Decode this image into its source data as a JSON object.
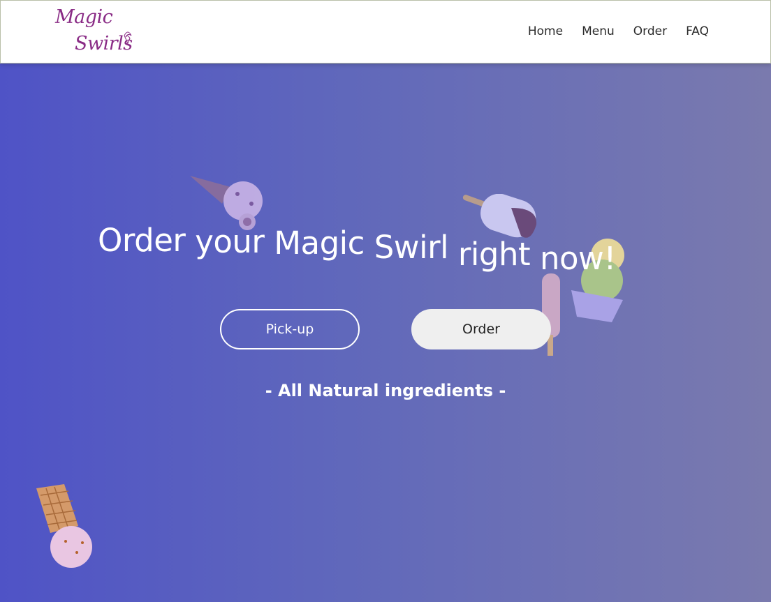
{
  "navbar": {
    "logo_line1": "Magic",
    "logo_line2": "Swirls",
    "links": [
      {
        "label": "Home"
      },
      {
        "label": "Menu"
      },
      {
        "label": "Order"
      },
      {
        "label": "FAQ"
      }
    ]
  },
  "hero": {
    "title_words": [
      "Order",
      "your",
      "Magic",
      "Swirl",
      "right",
      "now!"
    ],
    "pickup_label": "Pick-up",
    "order_label": "Order",
    "tagline": "- All Natural ingredients -"
  },
  "colors": {
    "gradient_start": "#4f53c6",
    "gradient_end": "#7a7aae",
    "logo": "#8a2c86",
    "order_button_bg": "#efefef"
  },
  "icons": [
    "ice-cream-cone-icon",
    "popsicle-icon",
    "ice-cream-cup-icon",
    "waffle-cone-icon"
  ]
}
